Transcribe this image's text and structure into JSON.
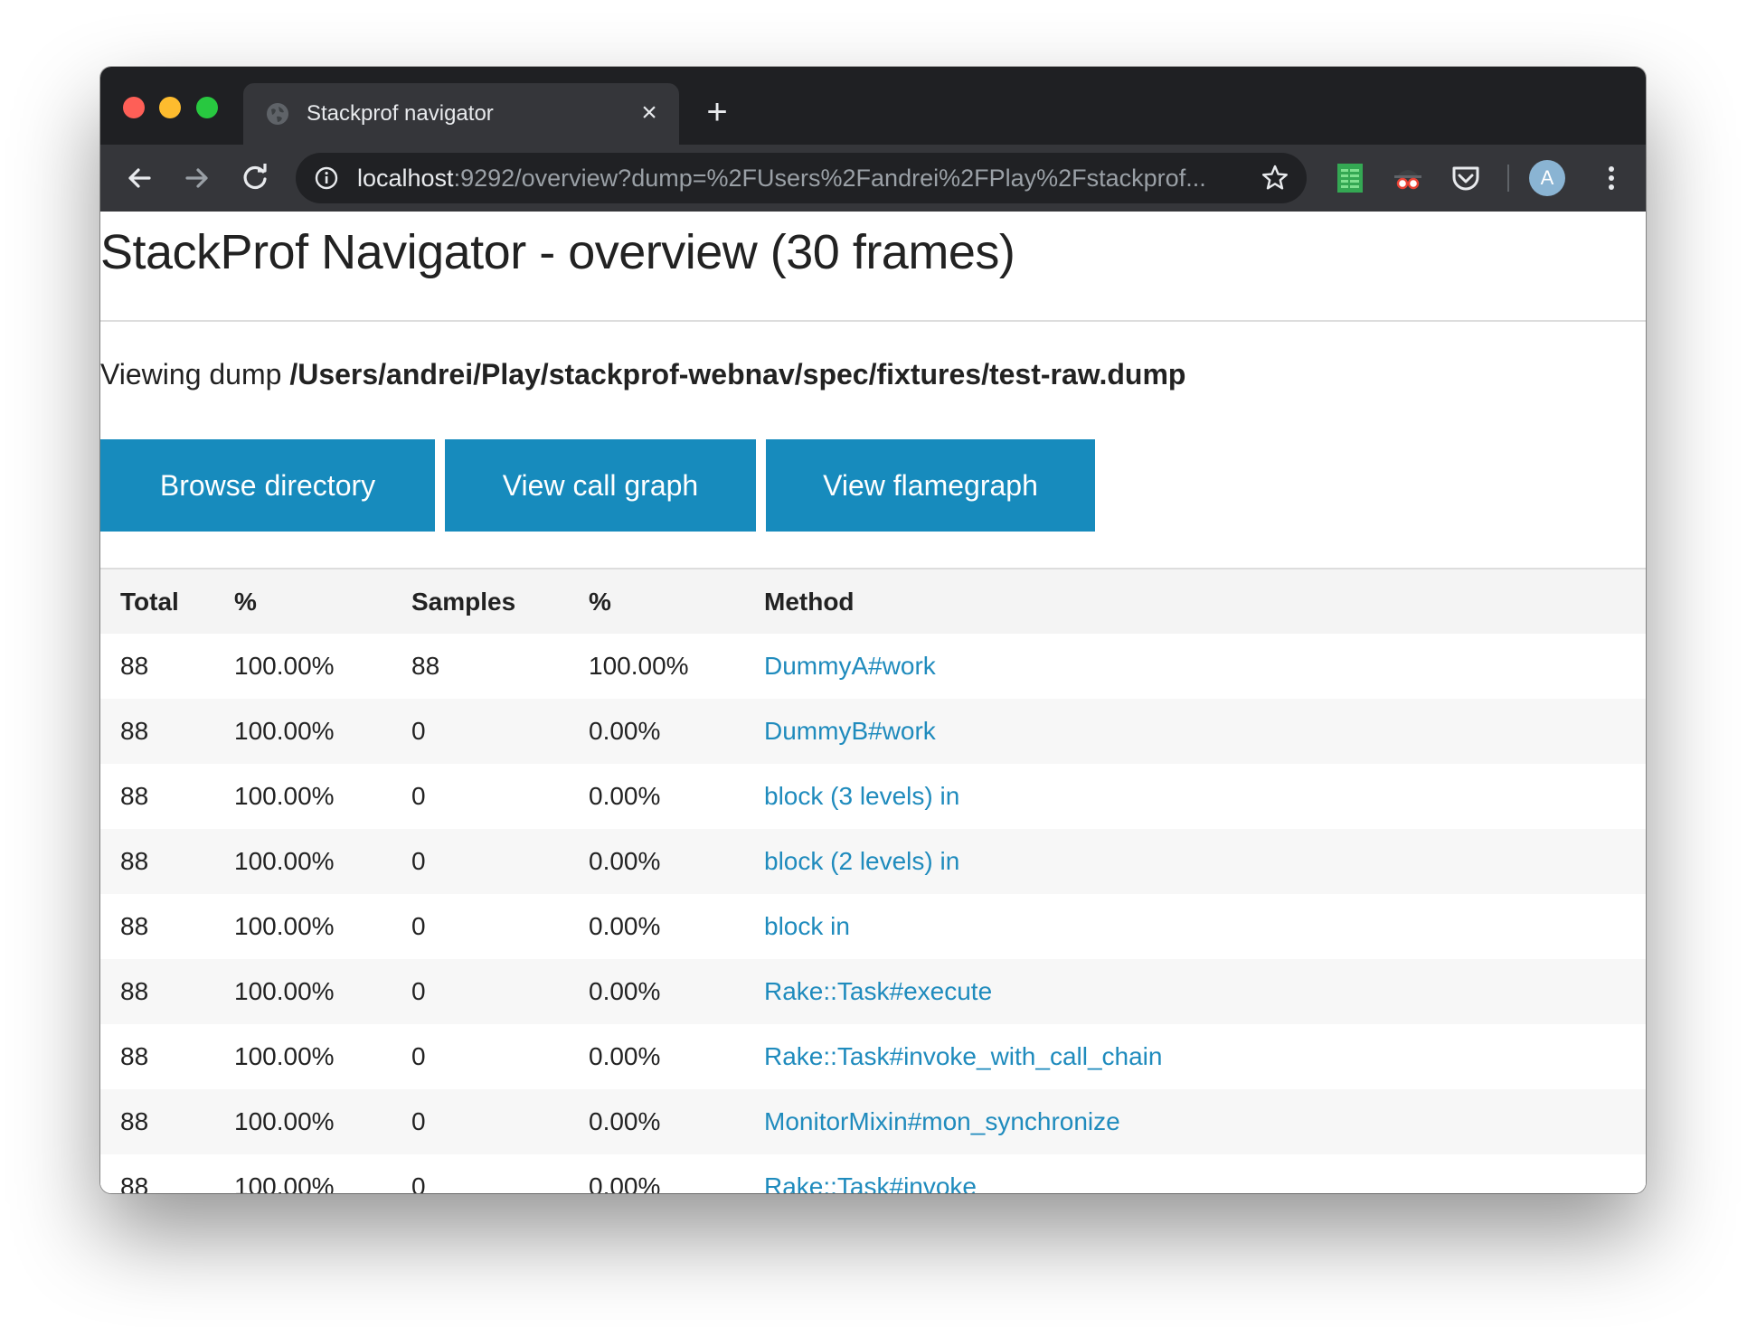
{
  "browser": {
    "tab_title": "Stackprof navigator",
    "tab_close": "×",
    "new_tab": "+",
    "url_host": "localhost",
    "url_rest": ":9292/overview?dump=%2FUsers%2Fandrei%2FPlay%2Fstackprof...",
    "avatar_letter": "A"
  },
  "page": {
    "title": "StackProf Navigator - overview (30 frames)",
    "viewing_prefix": "Viewing dump ",
    "dump_path": "/Users/andrei/Play/stackprof-webnav/spec/fixtures/test-raw.dump",
    "buttons": {
      "browse": "Browse directory",
      "call_graph": "View call graph",
      "flamegraph": "View flamegraph"
    }
  },
  "table": {
    "headers": [
      "Total",
      "%",
      "Samples",
      "%",
      "Method"
    ],
    "rows": [
      [
        "88",
        "100.00%",
        "88",
        "100.00%",
        "DummyA#work"
      ],
      [
        "88",
        "100.00%",
        "0",
        "0.00%",
        "DummyB#work"
      ],
      [
        "88",
        "100.00%",
        "0",
        "0.00%",
        "block (3 levels) in"
      ],
      [
        "88",
        "100.00%",
        "0",
        "0.00%",
        "block (2 levels) in"
      ],
      [
        "88",
        "100.00%",
        "0",
        "0.00%",
        "block in"
      ],
      [
        "88",
        "100.00%",
        "0",
        "0.00%",
        "Rake::Task#execute"
      ],
      [
        "88",
        "100.00%",
        "0",
        "0.00%",
        "Rake::Task#invoke_with_call_chain"
      ],
      [
        "88",
        "100.00%",
        "0",
        "0.00%",
        "MonitorMixin#mon_synchronize"
      ],
      [
        "88",
        "100.00%",
        "0",
        "0.00%",
        "Rake::Task#invoke"
      ]
    ]
  },
  "colors": {
    "button_bg": "#178bbd",
    "link": "#1f8bbd",
    "chrome_dark": "#1f2023",
    "chrome_toolbar": "#35363a"
  },
  "icons": [
    "globe-icon",
    "close-icon",
    "plus-icon",
    "back-arrow-icon",
    "forward-arrow-icon",
    "reload-icon",
    "info-icon",
    "star-icon",
    "spreadsheet-extension-icon",
    "spy-extension-icon",
    "pocket-icon",
    "kebab-menu-icon"
  ]
}
